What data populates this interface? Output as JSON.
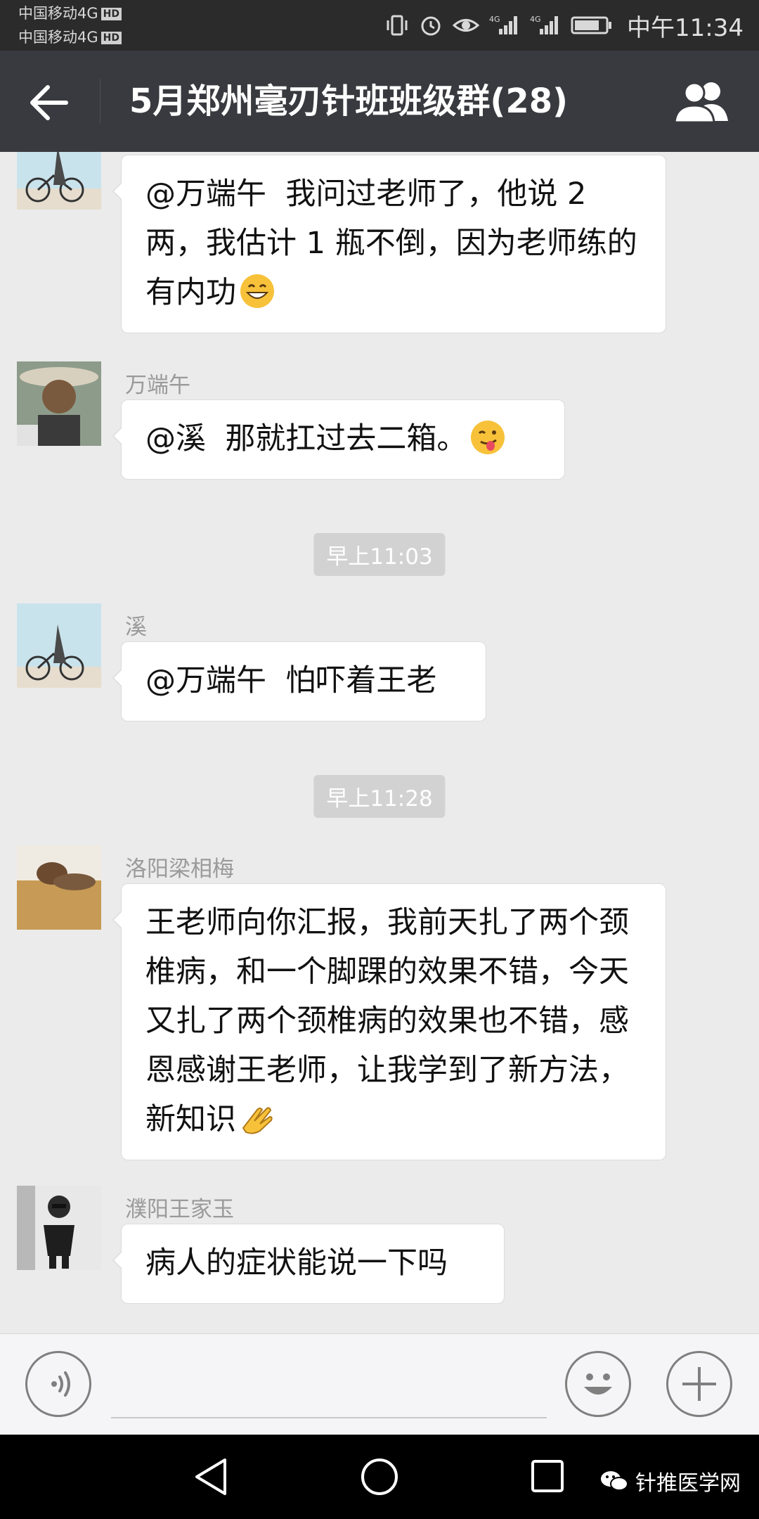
{
  "status_bar": {
    "carrier_1": "中国移动4G",
    "carrier_2": "中国移动4G",
    "hd_badge": "HD",
    "network_label_1": "4G",
    "network_label_2": "4G",
    "time": "中午11:34"
  },
  "title_bar": {
    "title": "5月郑州毫刃针班班级群(28)"
  },
  "messages": [
    {
      "sender": "",
      "text": "@万端午  我问过老师了，他说 2 两，我估计 1 瓶不倒，因为老师练的有内功",
      "emoji": "grin-emoji"
    },
    {
      "sender": "万端午",
      "text": "@溪  那就扛过去二箱。",
      "emoji": "wink-tongue-emoji"
    },
    {
      "sender": "溪",
      "text": "@万端午  怕吓着王老",
      "emoji": ""
    },
    {
      "sender": "洛阳梁相梅",
      "text": "王老师向你汇报，我前天扎了两个颈椎病，和一个脚踝的效果不错，今天又扎了两个颈椎病的效果也不错，感恩感谢王老师，让我学到了新方法，新知识",
      "emoji": "clap-hands-emoji"
    },
    {
      "sender": "濮阳王家玉",
      "text": "病人的症状能说一下吗",
      "emoji": ""
    }
  ],
  "timestamps": [
    "早上11:03",
    "早上11:28"
  ],
  "watermark": "针推医学网",
  "colors": {
    "title_bar": "#393a3f",
    "chat_bg": "#ebebeb",
    "bubble": "#ffffff",
    "timestamp_bg": "#d2d2d2"
  }
}
